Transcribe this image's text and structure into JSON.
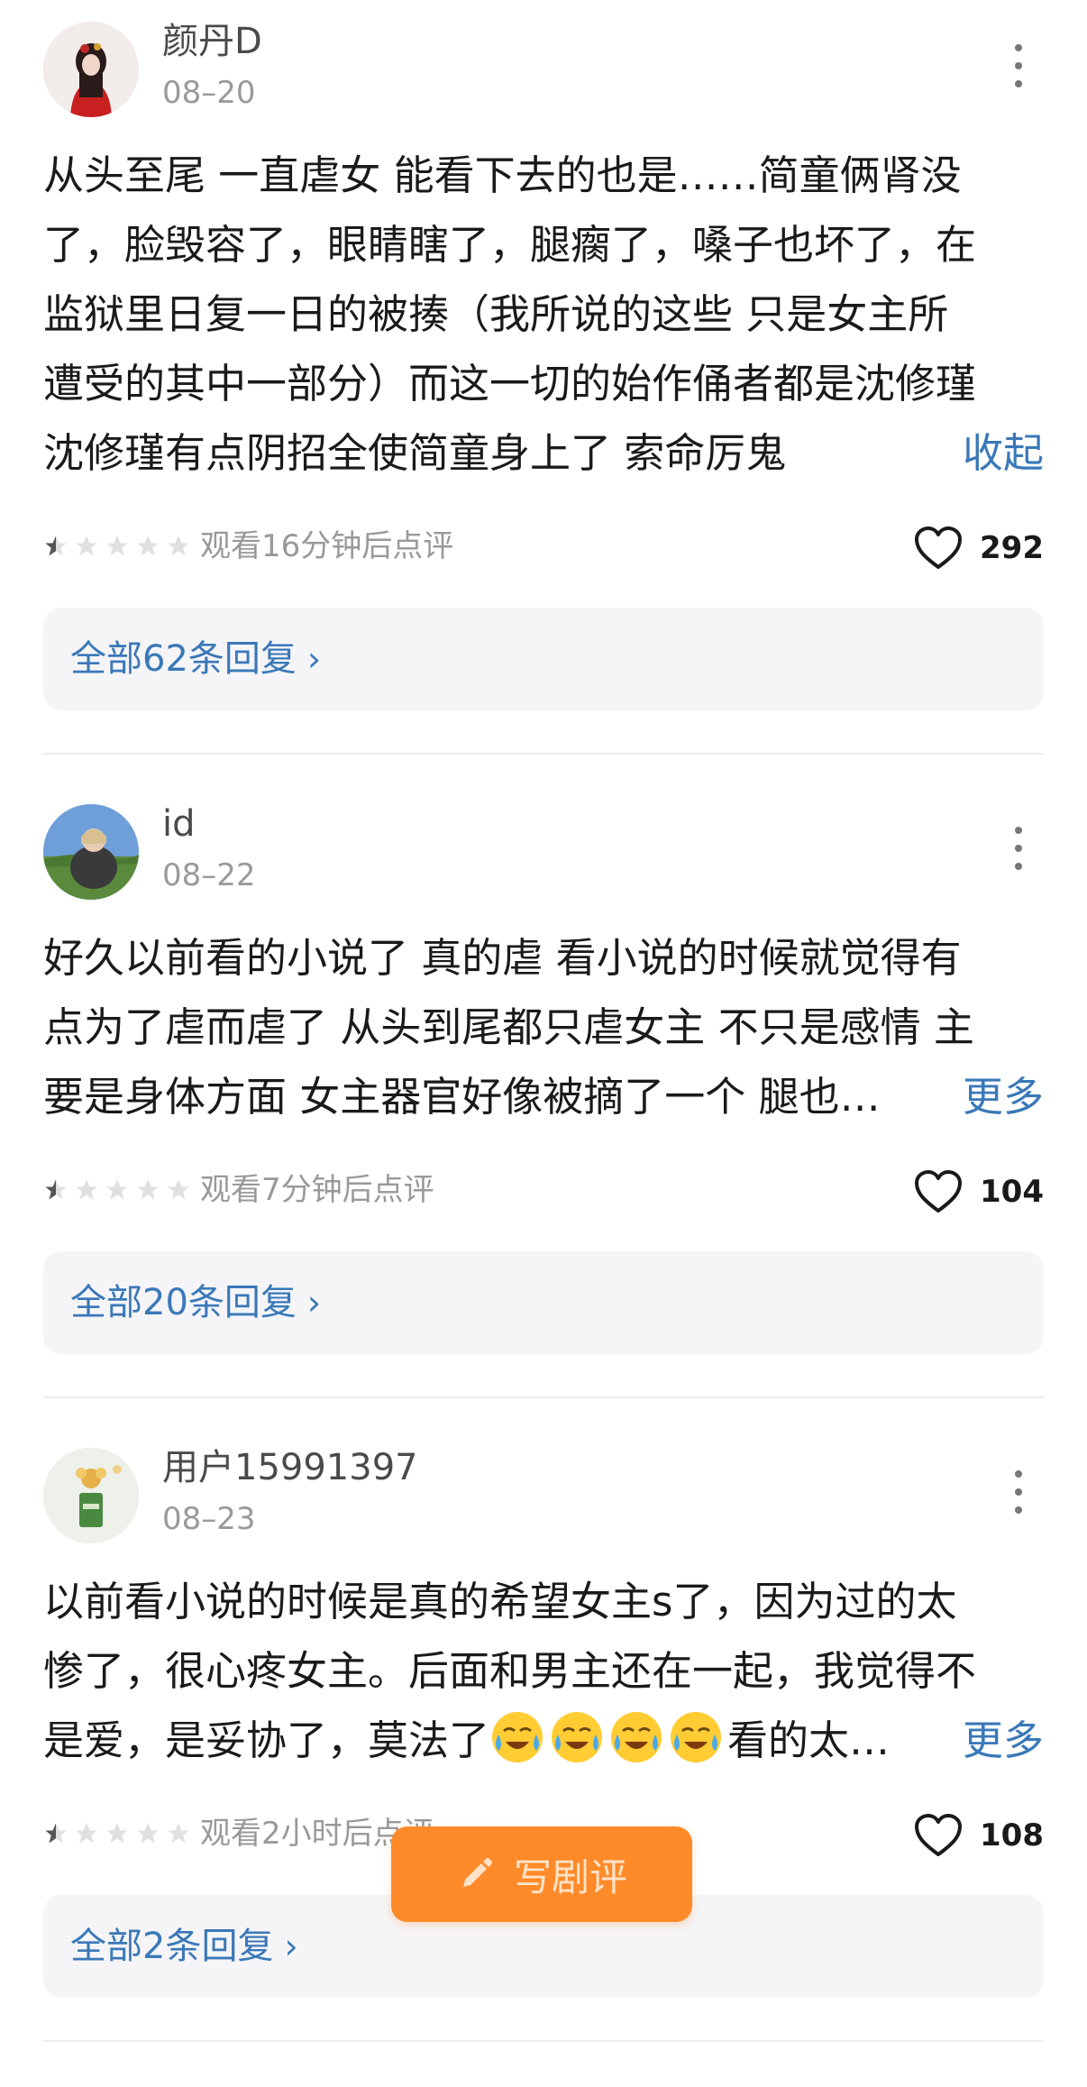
{
  "reviews": [
    {
      "username": "颜丹D",
      "date": "08–20",
      "lines": [
        "从头至尾 一直虐女 能看下去的也是……简童俩肾没",
        "了，脸毁容了，眼睛瞎了，腿瘸了，嗓子也坏了，在",
        "监狱里日复一日的被揍（我所说的这些 只是女主所",
        "遭受的其中一部分）而这一切的始作俑者都是沈修瑾",
        "沈修瑾有点阴招全使简童身上了 索命厉鬼"
      ],
      "toggle": "收起",
      "rating": 0.5,
      "watch_note": "观看16分钟后点评",
      "likes": "292",
      "replies": "全部62条回复"
    },
    {
      "username": "id",
      "date": "08–22",
      "lines": [
        "好久以前看的小说了 真的虐 看小说的时候就觉得有",
        "点为了虐而虐了 从头到尾都只虐女主 不只是感情 主",
        "要是身体方面 女主器官好像被摘了一个 腿也…"
      ],
      "toggle": "更多",
      "rating": 0.5,
      "watch_note": "观看7分钟后点评",
      "likes": "104",
      "replies": "全部20条回复"
    },
    {
      "username": "用户15991397",
      "date": "08–23",
      "lines": [
        "以前看小说的时候是真的希望女主s了，因为过的太",
        "惨了，很心疼女主。后面和男主还在一起，我觉得不",
        "是爱，是妥协了，莫法了",
        "看的太…"
      ],
      "emoji_count": 4,
      "emoji_icon": "crying-laughing-emoji",
      "toggle": "更多",
      "rating": 0.5,
      "watch_note": "观看2小时后点评",
      "likes": "108",
      "replies": "全部2条回复"
    }
  ],
  "chevron": "›",
  "write_button": {
    "label": "写剧评",
    "icon": "pencil-icon"
  },
  "colors": {
    "accent_blue": "#3a78b8",
    "orange": "#ff8a2a",
    "muted": "#999999"
  }
}
